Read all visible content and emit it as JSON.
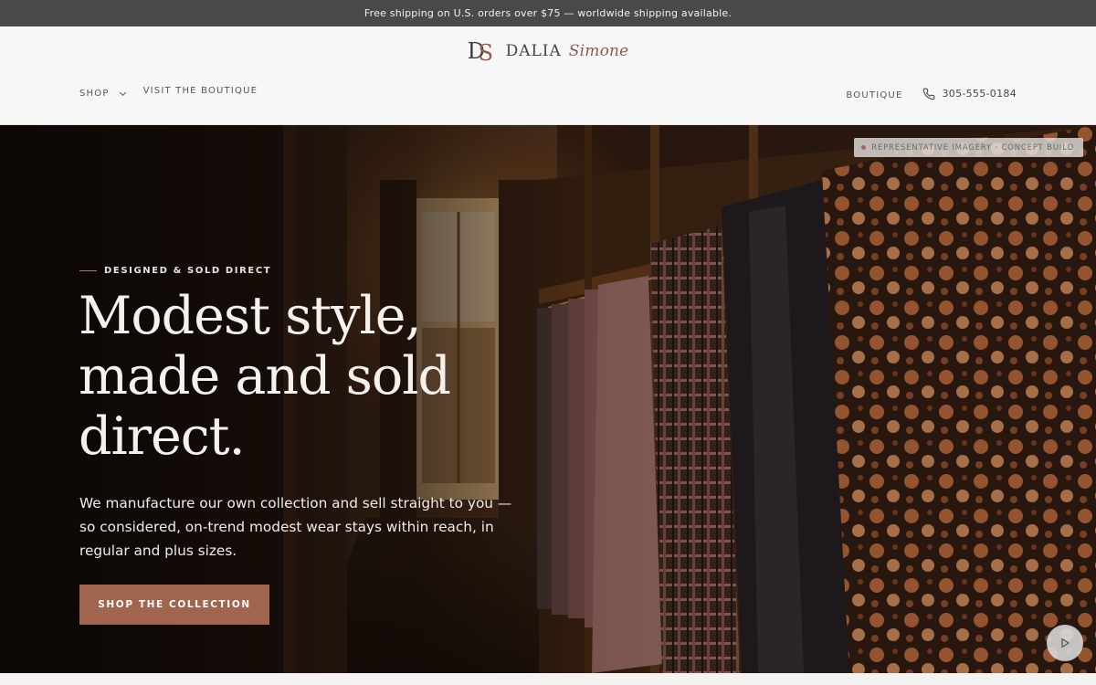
{
  "announcement": {
    "text": "Free shipping on U.S. orders over $75 — worldwide shipping available."
  },
  "header": {
    "logo": {
      "monogram_d": "D",
      "monogram_s": "S",
      "name": "DALIA",
      "script": "Simone"
    },
    "nav_left": [
      {
        "label": "SHOP",
        "has_dropdown": true
      },
      {
        "label": "VISIT THE BOUTIQUE",
        "has_dropdown": false
      }
    ],
    "nav_right": {
      "boutique": "BOUTIQUE",
      "phone": "305-555-0184",
      "phone_icon": "phone-icon"
    }
  },
  "hero": {
    "badge": "REPRESENTATIVE IMAGERY · CONCEPT BUILD",
    "eyebrow": "DESIGNED & SOLD DIRECT",
    "headline_lines": [
      "Modest style,",
      "made and sold",
      "direct."
    ],
    "lede": "We manufacture our own collection and sell straight to you — so considered, on-trend modest wear stays within reach, in regular and plus sizes.",
    "cta": "SHOP THE COLLECTION",
    "play_icon": "play-icon"
  },
  "colors": {
    "announcement_bg": "#494949",
    "accent": "#a0644f",
    "header_bg": "#f7f7f7"
  }
}
